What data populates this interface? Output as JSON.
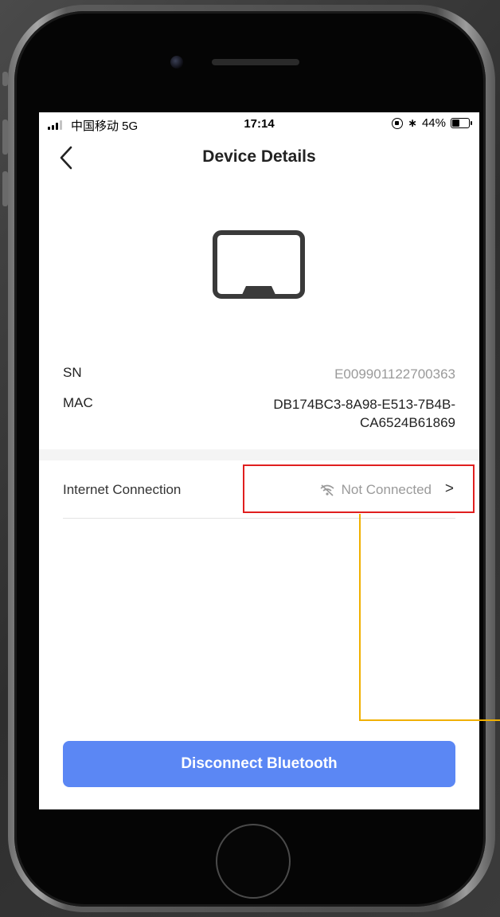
{
  "status_bar": {
    "carrier": "中国移动  5G",
    "time": "17:14",
    "battery": "44%"
  },
  "nav": {
    "title": "Device Details",
    "back_icon": "chevron-left-icon"
  },
  "device": {
    "icon": "tablet-device-icon",
    "sn_label": "SN",
    "sn_value": "E009901122700363",
    "mac_label": "MAC",
    "mac_value_line1": "DB174BC3-8A98-E513-7B4B-",
    "mac_value_line2": "CA6524B61869"
  },
  "connection": {
    "label": "Internet Connection",
    "status": "Not Connected",
    "status_icon": "wifi-off-icon",
    "chevron": ">"
  },
  "actions": {
    "disconnect_label": "Disconnect Bluetooth",
    "accent_color": "#5b87f4"
  },
  "annotation": {
    "highlight_color": "#e01f1f",
    "callout_color": "#f0b000"
  }
}
